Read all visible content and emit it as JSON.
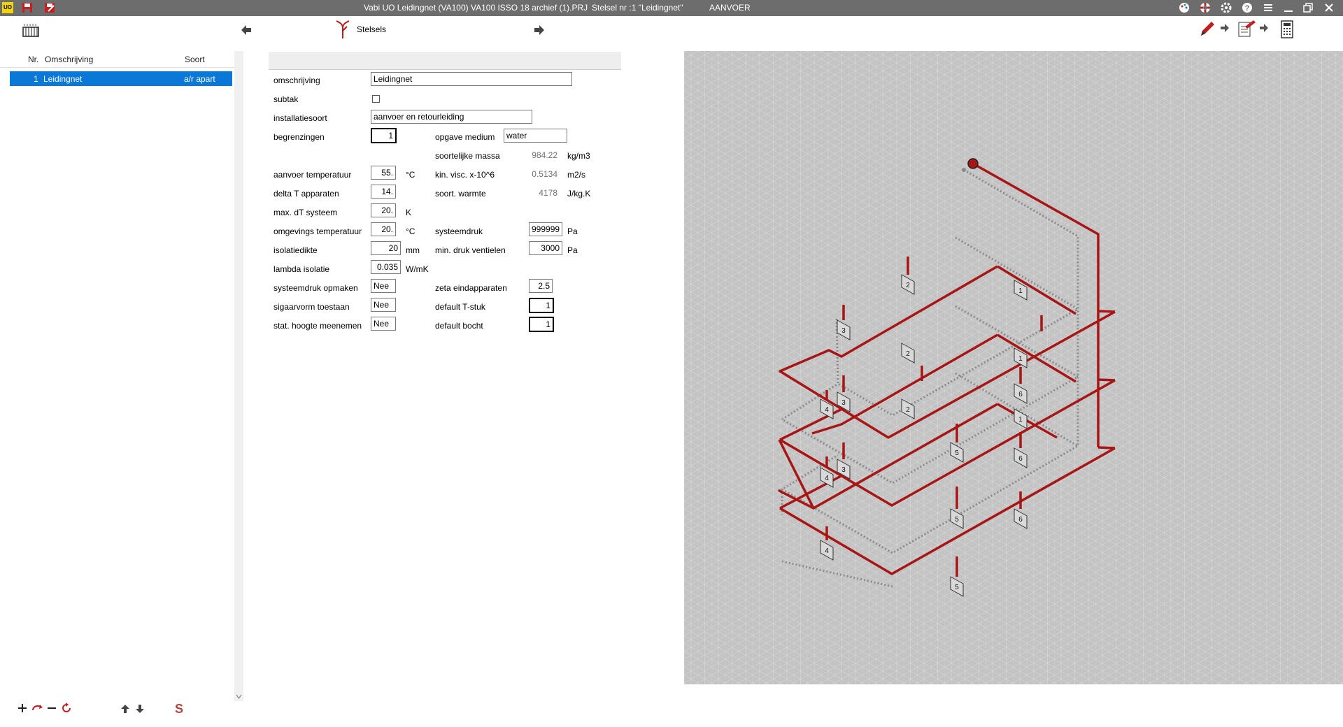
{
  "titlebar": {
    "app_badge": "UO",
    "title": "Vabi UO Leidingnet (VA100)  VA100 ISSO 18 archief (1).PRJ",
    "stelsel": "Stelsel nr   :1  \"Leidingnet\"",
    "mode": "AANVOER"
  },
  "toolbar": {
    "stelsels_label": "Stelsels"
  },
  "list": {
    "headers": {
      "nr": "Nr.",
      "omschrijving": "Omschrijving",
      "soort": "Soort"
    },
    "rows": [
      {
        "nr": "1",
        "omschrijving": "Leidingnet",
        "soort": "a/r apart"
      }
    ]
  },
  "form": {
    "omschrijving_label": "omschrijving",
    "omschrijving_value": "Leidingnet",
    "subtak_label": "subtak",
    "installatiesoort_label": "installatiesoort",
    "installatiesoort_value": "aanvoer en retourleiding",
    "begrenzingen_label": "begrenzingen",
    "begrenzingen_value": "1",
    "opgave_medium_label": "opgave medium",
    "opgave_medium_value": "water",
    "soortelijke_massa_label": "soortelijke massa",
    "soortelijke_massa_value": "984.22",
    "soortelijke_massa_unit": "kg/m3",
    "aanvoer_temp_label": "aanvoer temperatuur",
    "aanvoer_temp_value": "55.",
    "aanvoer_temp_unit": "°C",
    "kin_visc_label": "kin. visc. x-10^6",
    "kin_visc_value": "0.5134",
    "kin_visc_unit": "m2/s",
    "delta_t_label": "delta T apparaten",
    "delta_t_value": "14.",
    "soort_warmte_label": "soort. warmte",
    "soort_warmte_value": "4178",
    "soort_warmte_unit": "J/kg.K",
    "max_dt_label": "max. dT systeem",
    "max_dt_value": "20.",
    "max_dt_unit": "K",
    "omgevings_temp_label": "omgevings temperatuur",
    "omgevings_temp_value": "20.",
    "omgevings_temp_unit": "°C",
    "systeemdruk_label": "systeemdruk",
    "systeemdruk_value": "999999",
    "systeemdruk_unit": "Pa",
    "isolatiedikte_label": "isolatiedikte",
    "isolatiedikte_value": "20",
    "isolatiedikte_unit": "mm",
    "min_druk_label": "min. druk ventielen",
    "min_druk_value": "3000",
    "min_druk_unit": "Pa",
    "lambda_label": "lambda isolatie",
    "lambda_value": "0.035",
    "lambda_unit": "W/mK",
    "systeemdruk_opmaken_label": "systeemdruk opmaken",
    "systeemdruk_opmaken_value": "Nee",
    "zeta_label": "zeta eindapparaten",
    "zeta_value": "2.5",
    "sigaarvorm_label": "sigaarvorm toestaan",
    "sigaarvorm_value": "Nee",
    "default_tstuk_label": "default T-stuk",
    "default_tstuk_value": "1",
    "stat_hoogte_label": "stat. hoogte meenemen",
    "stat_hoogte_value": "Nee",
    "default_bocht_label": "default bocht",
    "default_bocht_value": "1"
  },
  "canvas": {
    "pipe_color": "#a81515",
    "return_color": "#8a8a8a",
    "grid_bg": "#c3c3c3",
    "tags": [
      {
        "n": "2"
      },
      {
        "n": "1"
      },
      {
        "n": "3"
      },
      {
        "n": "2"
      },
      {
        "n": "1"
      },
      {
        "n": "3"
      },
      {
        "n": "4"
      },
      {
        "n": "6"
      },
      {
        "n": "2"
      },
      {
        "n": "1"
      },
      {
        "n": "5"
      },
      {
        "n": "3"
      },
      {
        "n": "4"
      },
      {
        "n": "6"
      },
      {
        "n": "5"
      },
      {
        "n": "4"
      },
      {
        "n": "6"
      },
      {
        "n": "5"
      }
    ]
  },
  "icons": {
    "radiator": "radiator-icon",
    "arrow_left": "arrow-left-icon",
    "arrow_right": "arrow-right-icon",
    "pencil": "pencil-icon",
    "calculator": "calculator-icon"
  }
}
